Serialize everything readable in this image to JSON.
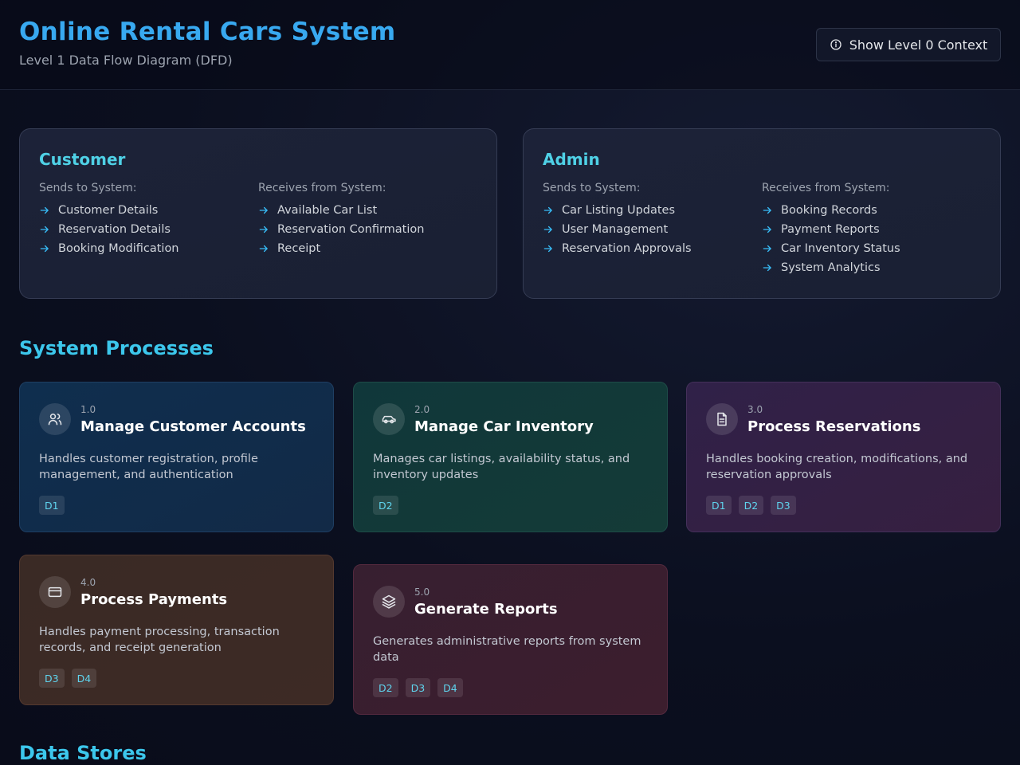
{
  "header": {
    "title": "Online Rental Cars System",
    "subtitle": "Level 1 Data Flow Diagram (DFD)",
    "context_button": "Show Level 0 Context"
  },
  "entities": [
    {
      "name": "Customer",
      "sends_label": "Sends to System:",
      "receives_label": "Receives from System:",
      "sends": [
        "Customer Details",
        "Reservation Details",
        "Booking Modification"
      ],
      "receives": [
        "Available Car List",
        "Reservation Confirmation",
        "Receipt"
      ]
    },
    {
      "name": "Admin",
      "sends_label": "Sends to System:",
      "receives_label": "Receives from System:",
      "sends": [
        "Car Listing Updates",
        "User Management",
        "Reservation Approvals"
      ],
      "receives": [
        "Booking Records",
        "Payment Reports",
        "Car Inventory Status",
        "System Analytics"
      ]
    }
  ],
  "processes_title": "System Processes",
  "processes": [
    {
      "number": "1.0",
      "title": "Manage Customer Accounts",
      "icon": "users-icon",
      "description": "Handles customer registration, profile management, and authentication",
      "stores": [
        "D1"
      ]
    },
    {
      "number": "2.0",
      "title": "Manage Car Inventory",
      "icon": "car-icon",
      "description": "Manages car listings, availability status, and inventory updates",
      "stores": [
        "D2"
      ]
    },
    {
      "number": "3.0",
      "title": "Process Reservations",
      "icon": "document-icon",
      "description": "Handles booking creation, modifications, and reservation approvals",
      "stores": [
        "D1",
        "D2",
        "D3"
      ]
    },
    {
      "number": "4.0",
      "title": "Process Payments",
      "icon": "credit-card-icon",
      "description": "Handles payment processing, transaction records, and receipt generation",
      "stores": [
        "D3",
        "D4"
      ]
    },
    {
      "number": "5.0",
      "title": "Generate Reports",
      "icon": "layers-icon",
      "description": "Generates administrative reports from system data",
      "stores": [
        "D2",
        "D3",
        "D4"
      ]
    }
  ],
  "data_stores_title": "Data Stores"
}
